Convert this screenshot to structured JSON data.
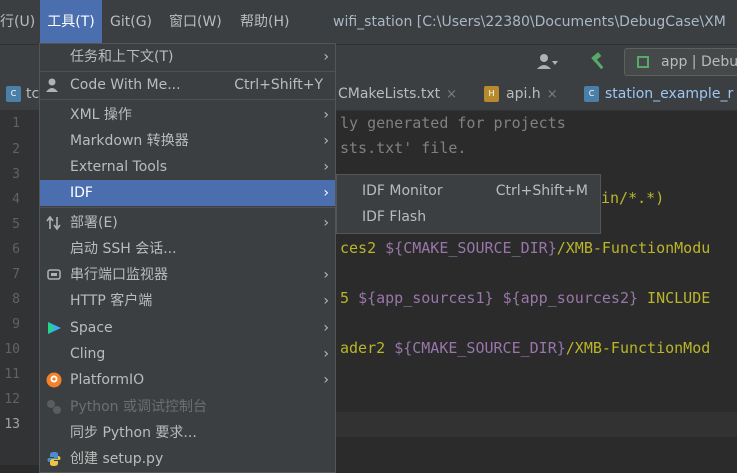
{
  "menubar": {
    "run_menu": "行(U)",
    "tools_menu": "工具(T)",
    "git_menu": "Git(G)",
    "window_menu": "窗口(W)",
    "help_menu": "帮助(H)",
    "window_title": "wifi_station [C:\\Users\\22380\\Documents\\DebugCase\\XM"
  },
  "toolbar": {
    "run_config": "app | Debu"
  },
  "tabs": [
    {
      "label": "tc"
    },
    {
      "label": "CMakeLists.txt",
      "close": "×"
    },
    {
      "label": "api.h",
      "close": "×",
      "icon": "H"
    },
    {
      "label": "station_example_r"
    }
  ],
  "gutter": {
    "lines": [
      "1",
      "2",
      "3",
      "4",
      "5",
      "6",
      "7",
      "8",
      "9",
      "10",
      "11",
      "12",
      "13"
    ]
  },
  "code": {
    "line1": "ly generated for projects",
    "line2": "sts.txt' file.",
    "line4_a": "in/*.*",
    "line4_b": ")",
    "line6_a": "ces2 ",
    "line6_b": "${CMAKE_SOURCE_DIR}",
    "line6_c": "/XMB-FunctionModu",
    "line8_a": "5 ",
    "line8_b": "${app_sources1}",
    "line8_c": " ",
    "line8_d": "${app_sources2}",
    "line8_e": " INCLUDE",
    "line10_a": "ader2 ",
    "line10_b": "${CMAKE_SOURCE_DIR}",
    "line10_c": "/XMB-FunctionMod"
  },
  "menu": {
    "items": [
      {
        "label": "任务和上下文(T)",
        "arrow": "›"
      },
      {
        "label": "Code With Me...",
        "shortcut": "Ctrl+Shift+Y"
      },
      {
        "label": "XML 操作",
        "arrow": "›"
      },
      {
        "label": "Markdown 转换器",
        "arrow": "›"
      },
      {
        "label": "External Tools",
        "arrow": "›"
      },
      {
        "label": "IDF",
        "arrow": "›"
      },
      {
        "label": "部署(E)",
        "arrow": "›"
      },
      {
        "label": "启动 SSH 会话..."
      },
      {
        "label": "串行端口监视器",
        "arrow": "›"
      },
      {
        "label": "HTTP 客户端",
        "arrow": "›"
      },
      {
        "label": "Space",
        "arrow": "›"
      },
      {
        "label": "Cling",
        "arrow": "›"
      },
      {
        "label": "PlatformIO",
        "arrow": "›"
      },
      {
        "label": "Python 或调试控制台"
      },
      {
        "label": "同步 Python 要求..."
      },
      {
        "label": "创建 setup.py"
      }
    ]
  },
  "submenu": {
    "items": [
      {
        "label": "IDF Monitor",
        "shortcut": "Ctrl+Shift+M"
      },
      {
        "label": "IDF Flash"
      }
    ]
  },
  "colors": {
    "selection": "#4b6eaf",
    "menu_bg": "#3c3f41",
    "editor_bg": "#2b2b2b"
  }
}
